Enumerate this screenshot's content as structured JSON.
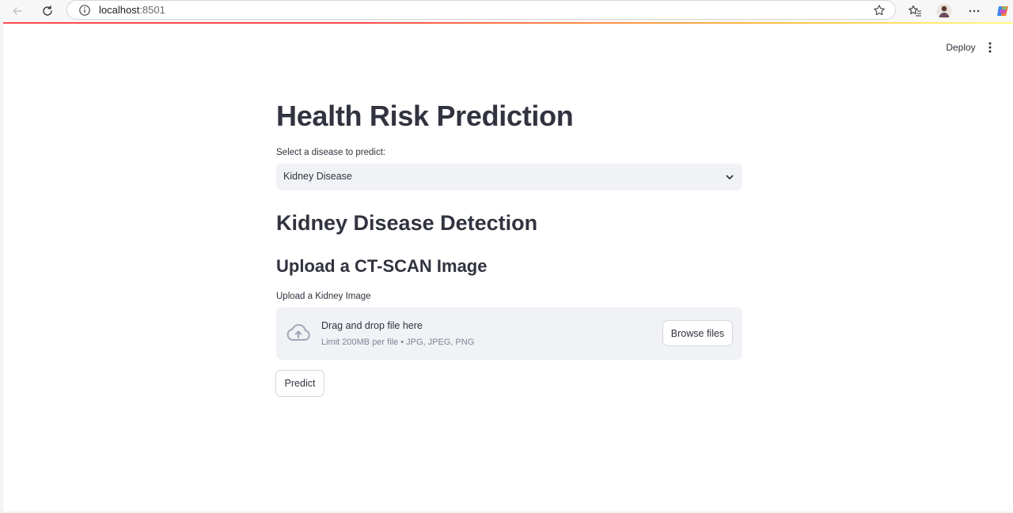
{
  "browser": {
    "url_host": "localhost",
    "url_port": ":8501"
  },
  "header": {
    "deploy_label": "Deploy"
  },
  "main": {
    "title": "Health Risk Prediction",
    "select_label": "Select a disease to predict:",
    "select_value": "Kidney Disease",
    "section_title": "Kidney Disease Detection",
    "subsection_title": "Upload a CT-SCAN Image",
    "upload_label": "Upload a Kidney Image",
    "dropzone_title": "Drag and drop file here",
    "dropzone_subtitle": "Limit 200MB per file • JPG, JPEG, PNG",
    "browse_label": "Browse files",
    "predict_label": "Predict"
  },
  "colors": {
    "primary_text": "#31333f",
    "input_bg": "#f0f2f6",
    "accent": "#ff4b4b",
    "muted_text": "#808495"
  }
}
